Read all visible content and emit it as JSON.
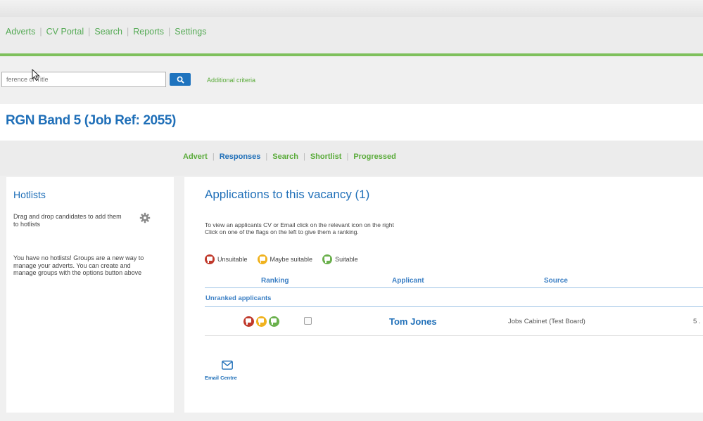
{
  "nav": {
    "items": [
      "Adverts",
      "CV Portal",
      "Search",
      "Reports",
      "Settings"
    ]
  },
  "search": {
    "placeholder": "ference or Title",
    "button_icon": "search-icon",
    "additional_criteria": "Additional criteria"
  },
  "page": {
    "title": "RGN Band 5 (Job Ref: 2055)"
  },
  "subnav": {
    "items": [
      "Advert",
      "Responses",
      "Search",
      "Shortlist",
      "Progressed"
    ],
    "active": "Responses"
  },
  "hotlists": {
    "heading": "Hotlists",
    "drag_text": "Drag and drop candidates to add them to hotlists",
    "settings_icon": "gear-icon",
    "no_hotlists_text": "You have no hotlists! Groups are a new way to manage your adverts. You can create and manage groups with the options button above"
  },
  "applications": {
    "heading": "Applications to this vacancy (1)",
    "instruction_line1": "To view an applicants CV or Email click on the relevant icon on the right",
    "instruction_line2": "Click on one of the flags on the left to give them a ranking.",
    "legend": {
      "unsuitable": "Unsuitable",
      "maybe": "Maybe suitable",
      "suitable": "Suitable"
    },
    "columns": {
      "ranking": "Ranking",
      "applicant": "Applicant",
      "source": "Source"
    },
    "group_label": "Unranked applicants",
    "rows": [
      {
        "applicant": "Tom Jones",
        "source": "Jobs Cabinet (Test Board)",
        "extra": "5 ."
      }
    ],
    "email_centre": "Email Centre"
  },
  "colors": {
    "brand_blue": "#1f6fb8",
    "nav_green": "#55aa55",
    "flag_red": "#c0392b",
    "flag_yellow": "#f0b21e",
    "flag_green": "#6ab04c"
  }
}
